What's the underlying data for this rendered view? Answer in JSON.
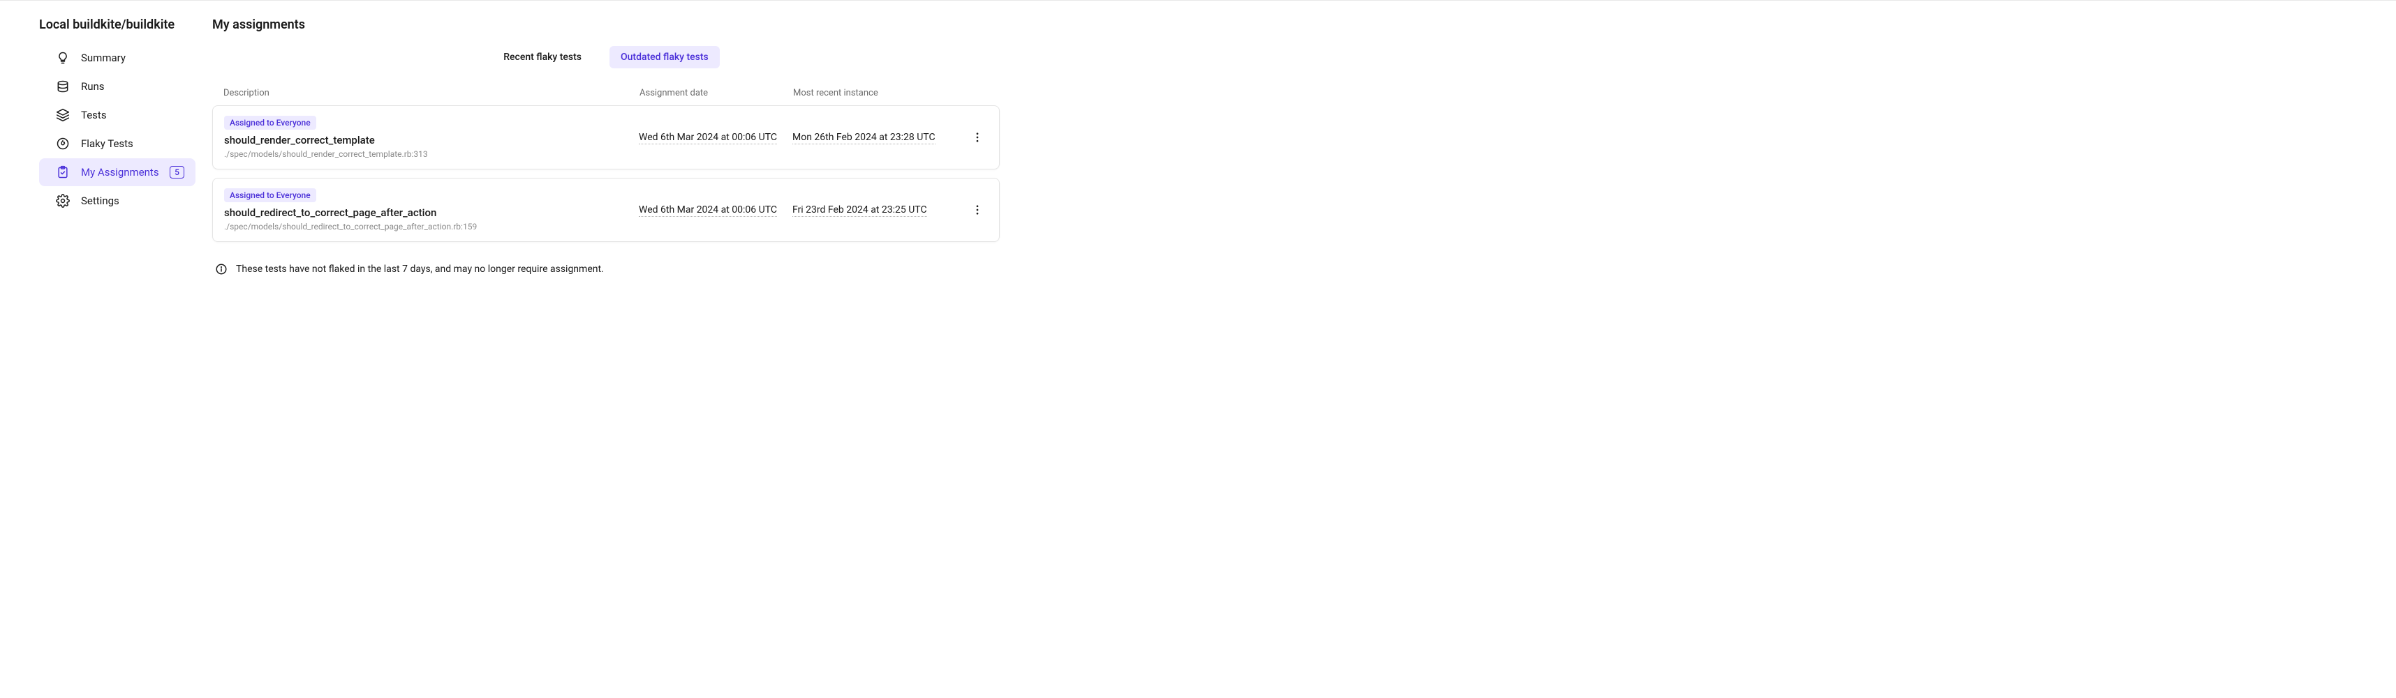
{
  "sidebar": {
    "title": "Local buildkite/buildkite",
    "items": [
      {
        "label": "Summary"
      },
      {
        "label": "Runs"
      },
      {
        "label": "Tests"
      },
      {
        "label": "Flaky Tests"
      },
      {
        "label": "My Assignments",
        "badge": "5"
      },
      {
        "label": "Settings"
      }
    ]
  },
  "page": {
    "title": "My assignments"
  },
  "tabs": {
    "recent": "Recent flaky tests",
    "outdated": "Outdated flaky tests"
  },
  "columns": {
    "description": "Description",
    "assignment_date": "Assignment date",
    "most_recent": "Most recent instance"
  },
  "rows": [
    {
      "badge": "Assigned to Everyone",
      "name": "should_render_correct_template",
      "path": "./spec/models/should_render_correct_template.rb:313",
      "assignment_date": "Wed 6th Mar 2024 at 00:06 UTC",
      "most_recent": "Mon 26th Feb 2024 at 23:28 UTC"
    },
    {
      "badge": "Assigned to Everyone",
      "name": "should_redirect_to_correct_page_after_action",
      "path": "./spec/models/should_redirect_to_correct_page_after_action.rb:159",
      "assignment_date": "Wed 6th Mar 2024 at 00:06 UTC",
      "most_recent": "Fri 23rd Feb 2024 at 23:25 UTC"
    }
  ],
  "info": "These tests have not flaked in the last 7 days, and may no longer require assignment."
}
